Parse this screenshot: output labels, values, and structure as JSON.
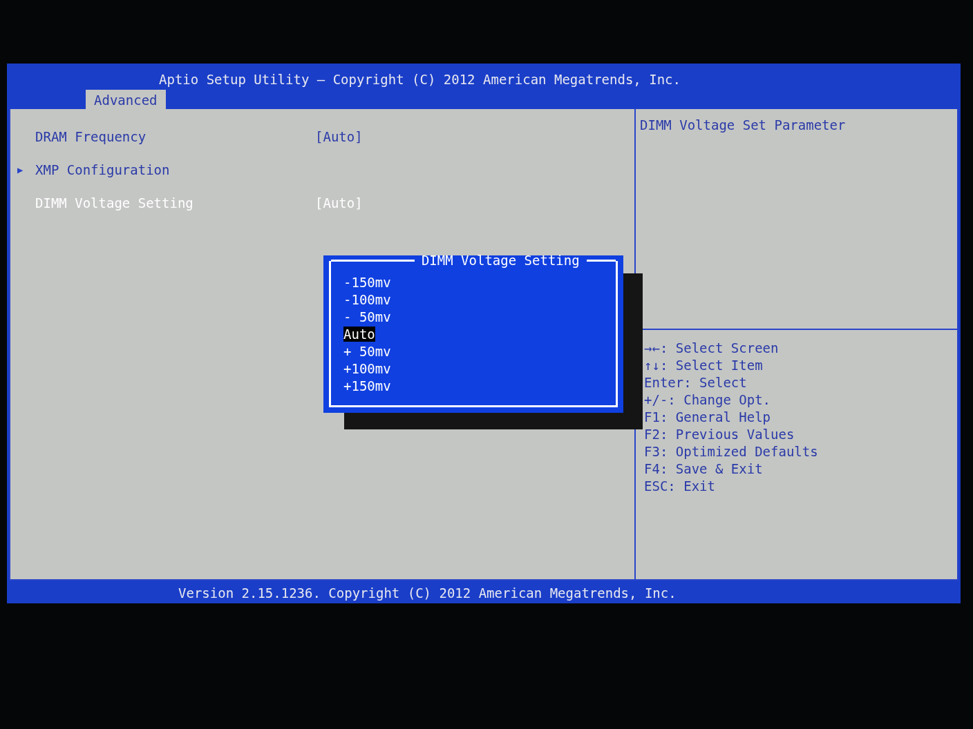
{
  "title": "Aptio Setup Utility – Copyright (C) 2012 American Megatrends, Inc.",
  "tabs": [
    {
      "label": "Advanced",
      "selected": true
    }
  ],
  "settings": [
    {
      "kind": "value",
      "label": "DRAM Frequency",
      "value": "[Auto]",
      "selected": false
    },
    {
      "kind": "submenu",
      "marker": "▶",
      "label": "XMP Configuration",
      "selected": false
    },
    {
      "kind": "value",
      "label": "DIMM Voltage Setting",
      "value": "[Auto]",
      "selected": true
    }
  ],
  "help": "DIMM Voltage Set Parameter",
  "keys": [
    "→←: Select Screen",
    "↑↓: Select Item",
    "Enter: Select",
    "+/-: Change Opt.",
    "F1: General Help",
    "F2: Previous Values",
    "F3: Optimized Defaults",
    "F4: Save & Exit",
    "ESC: Exit"
  ],
  "popup": {
    "title": "DIMM Voltage Setting",
    "options": [
      {
        "label": "-150mv",
        "selected": false
      },
      {
        "label": "-100mv",
        "selected": false
      },
      {
        "label": "- 50mv",
        "selected": false
      },
      {
        "label": "Auto",
        "selected": true
      },
      {
        "label": "+ 50mv",
        "selected": false
      },
      {
        "label": "+100mv",
        "selected": false
      },
      {
        "label": "+150mv",
        "selected": false
      }
    ]
  },
  "footer": "Version 2.15.1236. Copyright (C) 2012 American Megatrends, Inc."
}
